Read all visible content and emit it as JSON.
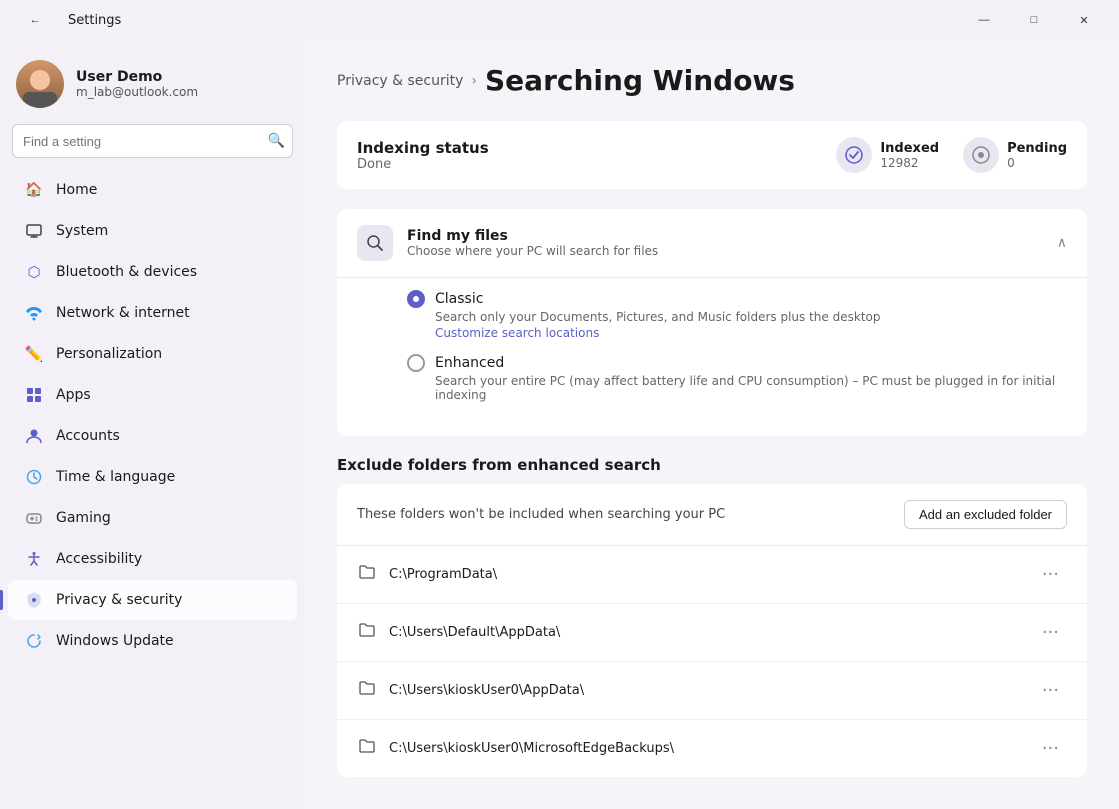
{
  "titlebar": {
    "back_icon": "←",
    "title": "Settings",
    "minimize_label": "—",
    "maximize_label": "□",
    "close_label": "✕"
  },
  "user": {
    "name": "User Demo",
    "email": "m_lab@outlook.com"
  },
  "search": {
    "placeholder": "Find a setting"
  },
  "nav": {
    "items": [
      {
        "id": "home",
        "label": "Home",
        "icon": "🏠"
      },
      {
        "id": "system",
        "label": "System",
        "icon": "🖥"
      },
      {
        "id": "bluetooth",
        "label": "Bluetooth & devices",
        "icon": "🔷"
      },
      {
        "id": "network",
        "label": "Network & internet",
        "icon": "🌐"
      },
      {
        "id": "personalization",
        "label": "Personalization",
        "icon": "✏️"
      },
      {
        "id": "apps",
        "label": "Apps",
        "icon": "📦"
      },
      {
        "id": "accounts",
        "label": "Accounts",
        "icon": "👤"
      },
      {
        "id": "time",
        "label": "Time & language",
        "icon": "🕐"
      },
      {
        "id": "gaming",
        "label": "Gaming",
        "icon": "🎮"
      },
      {
        "id": "accessibility",
        "label": "Accessibility",
        "icon": "♿"
      },
      {
        "id": "privacy",
        "label": "Privacy & security",
        "icon": "🛡",
        "active": true
      },
      {
        "id": "update",
        "label": "Windows Update",
        "icon": "🔄"
      }
    ]
  },
  "breadcrumb": {
    "parent": "Privacy & security",
    "arrow": "›",
    "current": "Searching Windows"
  },
  "indexing": {
    "title": "Indexing status",
    "status": "Done",
    "indexed_label": "Indexed",
    "indexed_value": "12982",
    "pending_label": "Pending",
    "pending_value": "0"
  },
  "find_my_files": {
    "title": "Find my files",
    "description": "Choose where your PC will search for files",
    "chevron": "∧",
    "classic": {
      "label": "Classic",
      "description": "Search only your Documents, Pictures, and Music folders plus the desktop",
      "link": "Customize search locations",
      "selected": true
    },
    "enhanced": {
      "label": "Enhanced",
      "description": "Search your entire PC (may affect battery life and CPU consumption) – PC must be plugged in for initial indexing",
      "selected": false
    }
  },
  "exclude_folders": {
    "section_title": "Exclude folders from enhanced search",
    "header_text": "These folders won't be included when searching your PC",
    "add_button": "Add an excluded folder",
    "folders": [
      {
        "path": "C:\\ProgramData\\"
      },
      {
        "path": "C:\\Users\\Default\\AppData\\"
      },
      {
        "path": "C:\\Users\\kioskUser0\\AppData\\"
      },
      {
        "path": "C:\\Users\\kioskUser0\\MicrosoftEdgeBackups\\"
      }
    ]
  }
}
